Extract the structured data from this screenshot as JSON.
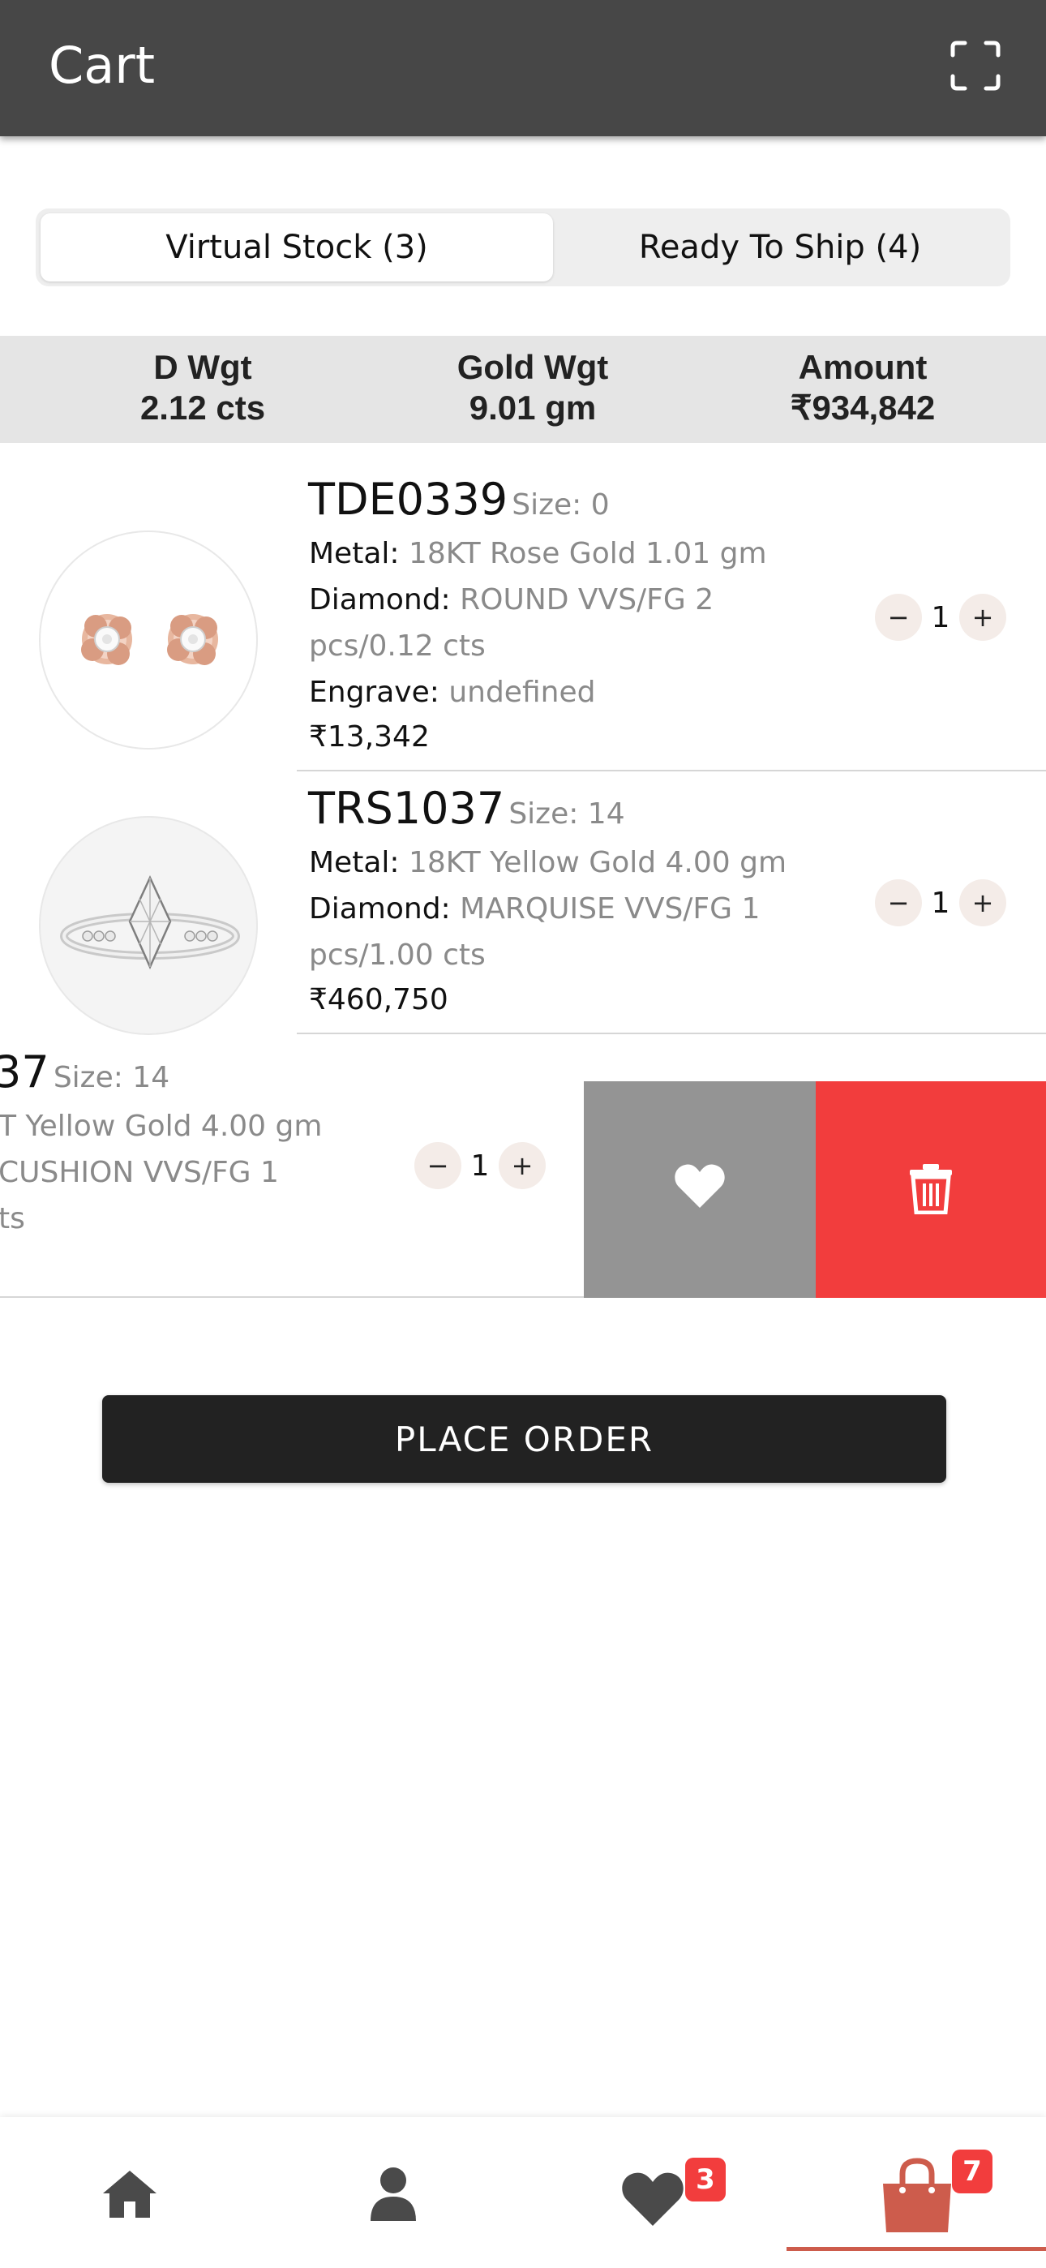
{
  "header": {
    "title": "Cart",
    "scan_icon": "fullscreen-scan-icon"
  },
  "tabs": [
    {
      "label": "Virtual Stock (3)",
      "active": true
    },
    {
      "label": "Ready To Ship (4)",
      "active": false
    }
  ],
  "summary": {
    "d_wgt_label": "D Wgt",
    "d_wgt_value": "2.12 cts",
    "gold_wgt_label": "Gold Wgt",
    "gold_wgt_value": "9.01 gm",
    "amount_label": "Amount",
    "amount_value": "₹934,842"
  },
  "items": [
    {
      "sku": "TDE0339",
      "size": "Size: 0",
      "metal_key": "Metal:",
      "metal_val": "18KT Rose Gold 1.01 gm",
      "diamond_key": "Diamond:",
      "diamond_val_1": "ROUND VVS/FG 2",
      "diamond_val_2": "pcs/0.12 cts",
      "engrave_key": "Engrave:",
      "engrave_val": "undefined",
      "price": "₹13,342",
      "qty": "1"
    },
    {
      "sku": "TRS1037",
      "size": "Size: 14",
      "metal_key": "Metal:",
      "metal_val": "18KT Yellow Gold 4.00 gm",
      "diamond_key": "Diamond:",
      "diamond_val_1": "MARQUISE VVS/FG 1",
      "diamond_val_2": "pcs/1.00 cts",
      "price": "₹460,750",
      "qty": "1"
    },
    {
      "sku_partial": "37",
      "size": "Size: 14",
      "line1": "T Yellow Gold 4.00 gm",
      "line2": "CUSHION VVS/FG 1",
      "line3": "ts",
      "qty": "1"
    }
  ],
  "swipe_actions": {
    "wishlist_icon": "heart-icon",
    "delete_icon": "trash-icon"
  },
  "place_order_label": "PLACE ORDER",
  "bottom_nav": {
    "items": [
      "home-icon",
      "profile-icon",
      "wishlist-icon",
      "cart-bag-icon"
    ],
    "wishlist_badge": "3",
    "cart_badge": "7"
  },
  "colors": {
    "header": "#474747",
    "accent": "#cd5c4c",
    "delete": "#f23d3d",
    "wish": "#949494",
    "button": "#222222"
  }
}
